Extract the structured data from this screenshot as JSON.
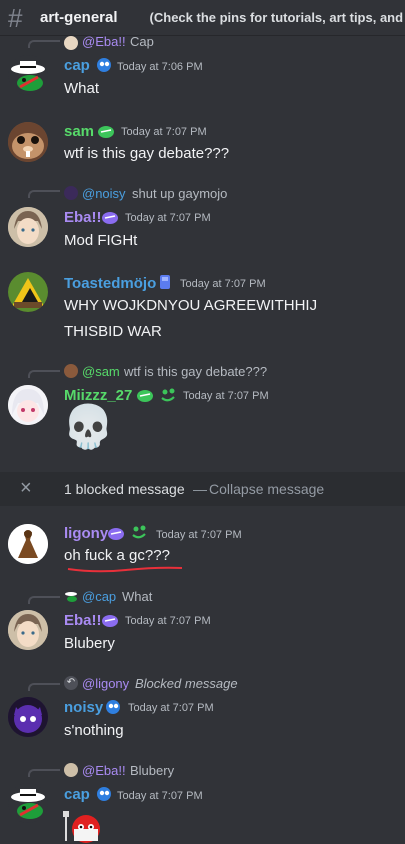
{
  "channel": {
    "name": "art-general",
    "topic": "(Check the pins for tutorials, art tips, and"
  },
  "messages": {
    "m1": {
      "reply_user": "@Eba!!",
      "reply_text": "Cap",
      "user": "cap",
      "time": "Today at 7:06 PM",
      "text": "What"
    },
    "m2": {
      "user": "sam",
      "time": "Today at 7:07 PM",
      "text": "wtf is this gay debate???"
    },
    "m3": {
      "reply_user": "@noisy",
      "reply_text": "shut up gaymojo",
      "user": "Eba!!",
      "time": "Today at 7:07 PM",
      "text": "Mod FIGHt"
    },
    "m4": {
      "user": "Toastedmöjo",
      "time": "Today at 7:07 PM",
      "text1": "WHY WOJKDNYOU AGREEWITHHIJ",
      "text2": "THISBID WAR"
    },
    "m5": {
      "reply_user": "@sam",
      "reply_text": "wtf is this gay debate???",
      "user": "Miizzz_27",
      "time": "Today at 7:07 PM",
      "emoji": "💀"
    },
    "blocked": {
      "close": "×",
      "text": "1 blocked message",
      "sep": "—",
      "action": "Collapse message"
    },
    "m6": {
      "user": "ligony",
      "time": "Today at 7:07 PM",
      "text": "oh fuck a gc???"
    },
    "m7": {
      "reply_user": "@cap",
      "reply_text": "What",
      "user": "Eba!!",
      "time": "Today at 7:07 PM",
      "text": "Blubery"
    },
    "m8": {
      "reply_user": "@ligony",
      "reply_text": "Blocked message",
      "user": "noisy",
      "time": "Today at 7:07 PM",
      "text": "s'nothing"
    },
    "m9": {
      "reply_user": "@Eba!!",
      "reply_text": "Blubery",
      "user": "cap",
      "time": "Today at 7:07 PM"
    }
  },
  "colors": {
    "background": "#313338",
    "cap": "#4a9fe0",
    "sam": "#57d96a",
    "eba": "#a98bf2",
    "toasted": "#4a9fe0",
    "miizzz": "#57d96a",
    "ligony": "#a98bf2",
    "noisy": "#4a9fe0",
    "squiggle": "#e8303a"
  },
  "icons": [
    "hashtag-icon",
    "skull-emoji",
    "close-icon",
    "reply-arrow-icon",
    "badge-icon"
  ]
}
